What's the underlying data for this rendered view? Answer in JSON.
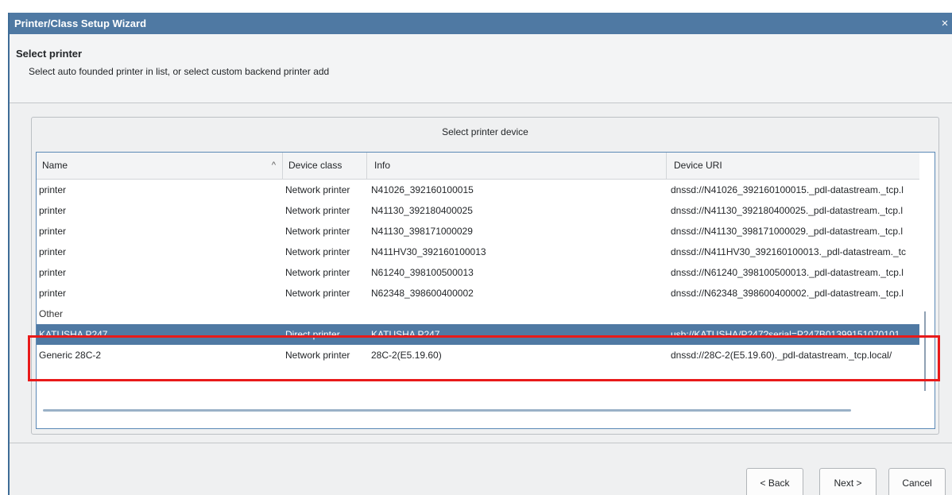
{
  "window": {
    "title": "Printer/Class Setup Wizard",
    "close_glyph": "×"
  },
  "header": {
    "title": "Select printer",
    "subtitle": "Select auto founded printer in list, or select custom backend printer add"
  },
  "group": {
    "title": "Select printer device"
  },
  "table": {
    "columns": [
      "Name",
      "Device class",
      "Info",
      "Device URI"
    ],
    "sort_glyph": "^",
    "rows": [
      {
        "name": "printer",
        "class": "Network printer",
        "info": "N41026_392160100015",
        "uri": "dnssd://N41026_392160100015._pdl-datastream._tcp.l"
      },
      {
        "name": "printer",
        "class": "Network printer",
        "info": "N41130_392180400025",
        "uri": "dnssd://N41130_392180400025._pdl-datastream._tcp.l"
      },
      {
        "name": "printer",
        "class": "Network printer",
        "info": "N41130_398171000029",
        "uri": "dnssd://N41130_398171000029._pdl-datastream._tcp.l"
      },
      {
        "name": "printer",
        "class": "Network printer",
        "info": "N411HV30_392160100013",
        "uri": "dnssd://N411HV30_392160100013._pdl-datastream._tc"
      },
      {
        "name": "printer",
        "class": "Network printer",
        "info": "N61240_398100500013",
        "uri": "dnssd://N61240_398100500013._pdl-datastream._tcp.l"
      },
      {
        "name": "printer",
        "class": "Network printer",
        "info": "N62348_398600400002",
        "uri": "dnssd://N62348_398600400002._pdl-datastream._tcp.l"
      },
      {
        "name": "Other",
        "class": "",
        "info": "",
        "uri": ""
      },
      {
        "name": "KATUSHA P247",
        "class": "Direct printer",
        "info": "KATUSHA P247",
        "uri": "usb://KATUSHA/P247?serial=P247B01399151070101"
      },
      {
        "name": "Generic 28C-2",
        "class": "Network printer",
        "info": "28C-2(E5.19.60)",
        "uri": "dnssd://28C-2(E5.19.60)._pdl-datastream._tcp.local/"
      }
    ],
    "selected_index": 7
  },
  "buttons": {
    "back": "< Back",
    "next": "Next >",
    "cancel": "Cancel"
  },
  "colors": {
    "titlebar": "#4f79a3",
    "selection": "#4f79a3",
    "highlight_box": "#e81a1a"
  }
}
